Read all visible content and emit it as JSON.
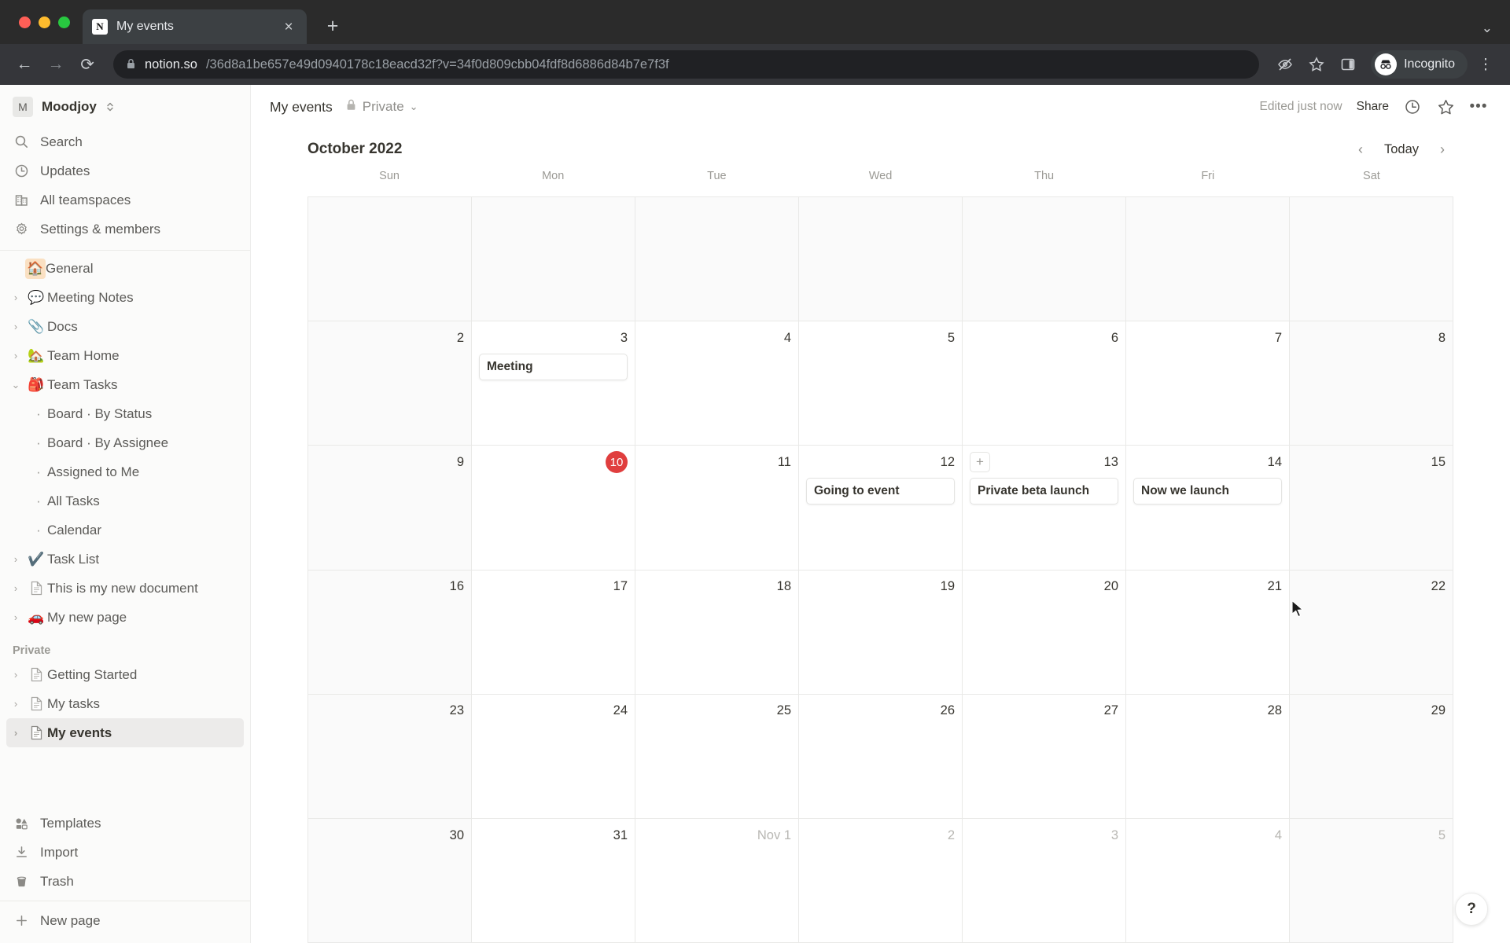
{
  "browser": {
    "tab": {
      "title": "My events",
      "favicon": "notion-logo-icon",
      "close_icon": "×"
    },
    "new_tab_icon": "+",
    "window_chevron_icon": "⌄",
    "back_icon": "←",
    "forward_icon": "→",
    "reload_icon": "⟳",
    "lock_icon": "🔒",
    "url_host": "notion.so",
    "url_path": "/36d8a1be657e49d0940178c18eacd32f?v=34f0d809cbb04fdf8d6886d84b7e7f3f",
    "eye_slash_icon": "eye-slash",
    "bookmark_icon": "star",
    "side_panel_icon": "panel",
    "profile_label": "Incognito",
    "menu_icon": "⋮"
  },
  "sidebar": {
    "workspace": {
      "initial": "M",
      "name": "Moodjoy",
      "switcher_icon": "chevrons-updown"
    },
    "nav": [
      {
        "label": "Search",
        "icon": "search-icon"
      },
      {
        "label": "Updates",
        "icon": "clock-icon"
      },
      {
        "label": "All teamspaces",
        "icon": "building-icon"
      },
      {
        "label": "Settings & members",
        "icon": "gear-icon"
      }
    ],
    "teamspace": [
      {
        "label": "General",
        "emoji": "🏠",
        "twisty": "",
        "highlight": true,
        "level": 0
      },
      {
        "label": "Meeting Notes",
        "emoji": "💬",
        "twisty": "›",
        "level": 0
      },
      {
        "label": "Docs",
        "emoji": "📎",
        "twisty": "›",
        "level": 0
      },
      {
        "label": "Team Home",
        "emoji": "🏡",
        "twisty": "›",
        "level": 0
      },
      {
        "label": "Team Tasks",
        "emoji": "🎒",
        "twisty": "⌄",
        "level": 0
      },
      {
        "label": "Board · By Status",
        "twisty": "",
        "level": 1
      },
      {
        "label": "Board · By Assignee",
        "twisty": "",
        "level": 1
      },
      {
        "label": "Assigned to Me",
        "twisty": "",
        "level": 1
      },
      {
        "label": "All Tasks",
        "twisty": "",
        "level": 1
      },
      {
        "label": "Calendar",
        "twisty": "",
        "level": 1
      },
      {
        "label": "Task List",
        "emoji": "✔️",
        "twisty": "›",
        "level": 0
      },
      {
        "label": "This is my new document",
        "icon": "page-icon",
        "twisty": "›",
        "level": 0
      },
      {
        "label": "My new page",
        "emoji": "🚗",
        "twisty": "›",
        "level": 0
      }
    ],
    "private_section_label": "Private",
    "private": [
      {
        "label": "Getting Started",
        "icon": "page-icon",
        "twisty": "›",
        "selected": false
      },
      {
        "label": "My tasks",
        "icon": "page-icon",
        "twisty": "›",
        "selected": false
      },
      {
        "label": "My events",
        "icon": "page-icon",
        "twisty": "›",
        "selected": true
      }
    ],
    "bottom": [
      {
        "label": "Templates",
        "icon": "templates-icon"
      },
      {
        "label": "Import",
        "icon": "import-icon"
      },
      {
        "label": "Trash",
        "icon": "trash-icon"
      }
    ],
    "new_page": {
      "label": "New page",
      "icon": "plus-icon"
    }
  },
  "header": {
    "title": "My events",
    "breadcrumb_lock_icon": "lock-icon",
    "breadcrumb_label": "Private",
    "breadcrumb_chevron": "⌄",
    "edited_label": "Edited just now",
    "share_label": "Share",
    "history_icon": "clock-icon",
    "favorite_icon": "star-icon",
    "more_icon": "•••"
  },
  "calendar": {
    "month_label": "October 2022",
    "prev_icon": "‹",
    "today_label": "Today",
    "next_icon": "›",
    "add_icon": "+",
    "day_headers": [
      "Sun",
      "Mon",
      "Tue",
      "Wed",
      "Thu",
      "Fri",
      "Sat"
    ],
    "weeks": [
      [
        {
          "blank": true
        },
        {
          "blank": true
        },
        {
          "blank": true
        },
        {
          "blank": true
        },
        {
          "blank": true
        },
        {
          "blank": true
        },
        {
          "blank": true
        }
      ],
      [
        {
          "day": "2",
          "events": []
        },
        {
          "day": "3",
          "events": [
            "Meeting"
          ]
        },
        {
          "day": "4",
          "events": []
        },
        {
          "day": "5",
          "events": []
        },
        {
          "day": "6",
          "events": []
        },
        {
          "day": "7",
          "events": []
        },
        {
          "day": "8",
          "events": []
        }
      ],
      [
        {
          "day": "9",
          "events": []
        },
        {
          "day": "10",
          "today": true,
          "events": []
        },
        {
          "day": "11",
          "events": []
        },
        {
          "day": "12",
          "events": [
            "Going to event"
          ]
        },
        {
          "day": "13",
          "events": [
            "Private beta launch"
          ],
          "add_button": true
        },
        {
          "day": "14",
          "events": [
            "Now we launch"
          ]
        },
        {
          "day": "15",
          "events": []
        }
      ],
      [
        {
          "day": "16",
          "events": []
        },
        {
          "day": "17",
          "events": []
        },
        {
          "day": "18",
          "events": []
        },
        {
          "day": "19",
          "events": []
        },
        {
          "day": "20",
          "events": []
        },
        {
          "day": "21",
          "events": []
        },
        {
          "day": "22",
          "events": []
        }
      ],
      [
        {
          "day": "23",
          "events": []
        },
        {
          "day": "24",
          "events": []
        },
        {
          "day": "25",
          "events": []
        },
        {
          "day": "26",
          "events": []
        },
        {
          "day": "27",
          "events": []
        },
        {
          "day": "28",
          "events": []
        },
        {
          "day": "29",
          "events": []
        }
      ],
      [
        {
          "day": "30",
          "events": []
        },
        {
          "day": "31",
          "events": []
        },
        {
          "day": "Nov 1",
          "muted": true,
          "events": []
        },
        {
          "day": "2",
          "muted": true,
          "events": []
        },
        {
          "day": "3",
          "muted": true,
          "events": []
        },
        {
          "day": "4",
          "muted": true,
          "events": []
        },
        {
          "day": "5",
          "muted": true,
          "events": []
        }
      ]
    ],
    "help_label": "?"
  },
  "colors": {
    "today_badge": "#e03e3e",
    "sidebar_bg": "#fbfbfa",
    "selected_row": "#ecebea",
    "browser_chrome": "#2b2b2b"
  }
}
